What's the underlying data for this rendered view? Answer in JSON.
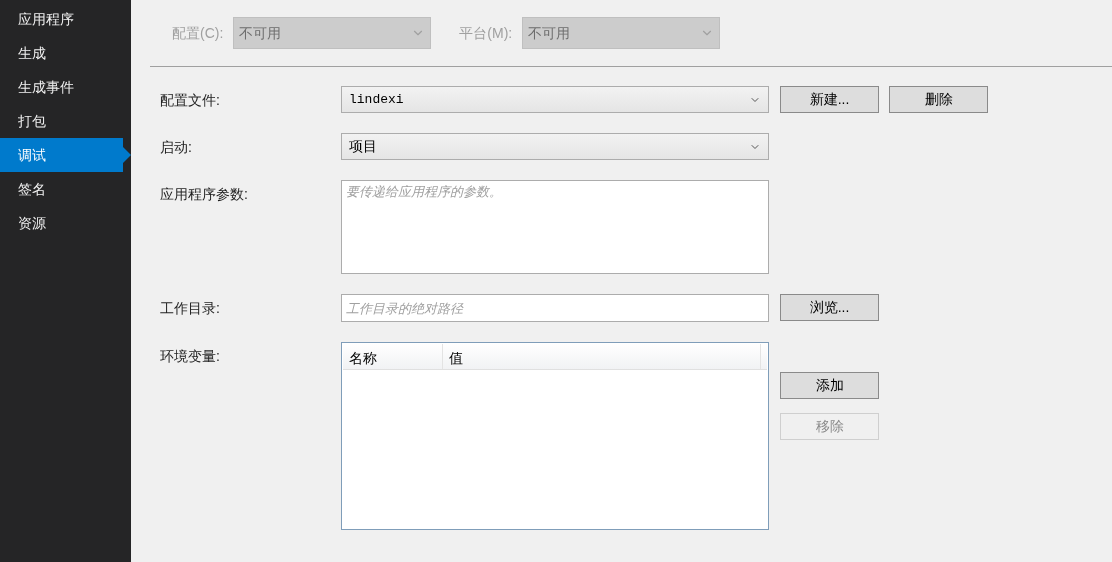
{
  "sidebar": {
    "items": [
      {
        "label": "应用程序",
        "selected": false
      },
      {
        "label": "生成",
        "selected": false
      },
      {
        "label": "生成事件",
        "selected": false
      },
      {
        "label": "打包",
        "selected": false
      },
      {
        "label": "调试",
        "selected": true
      },
      {
        "label": "签名",
        "selected": false
      },
      {
        "label": "资源",
        "selected": false
      }
    ]
  },
  "toolbar": [
    {
      "label": "配置(C):",
      "value": "不可用",
      "disabled": true
    },
    {
      "label": "平台(M):",
      "value": "不可用",
      "disabled": true
    }
  ],
  "form": [
    {
      "kind": "dropdown",
      "label": "配置文件:",
      "value": "lindexi",
      "monospace": true,
      "buttons": [
        {
          "label": "新建...",
          "disabled": false
        },
        {
          "label": "删除",
          "disabled": false
        }
      ]
    },
    {
      "kind": "dropdown",
      "label": "启动:",
      "value": "项目",
      "monospace": false
    },
    {
      "kind": "textarea",
      "label": "应用程序参数:",
      "placeholder": "要传递给应用程序的参数。"
    },
    {
      "kind": "text",
      "label": "工作目录:",
      "placeholder": "工作目录的绝对路径",
      "buttons": [
        {
          "label": "浏览...",
          "disabled": false
        }
      ]
    },
    {
      "kind": "list",
      "label": "环境变量:",
      "columns": [
        "名称",
        "值"
      ],
      "buttons": [
        {
          "label": "添加",
          "disabled": false
        },
        {
          "label": "移除",
          "disabled": true
        }
      ]
    }
  ]
}
